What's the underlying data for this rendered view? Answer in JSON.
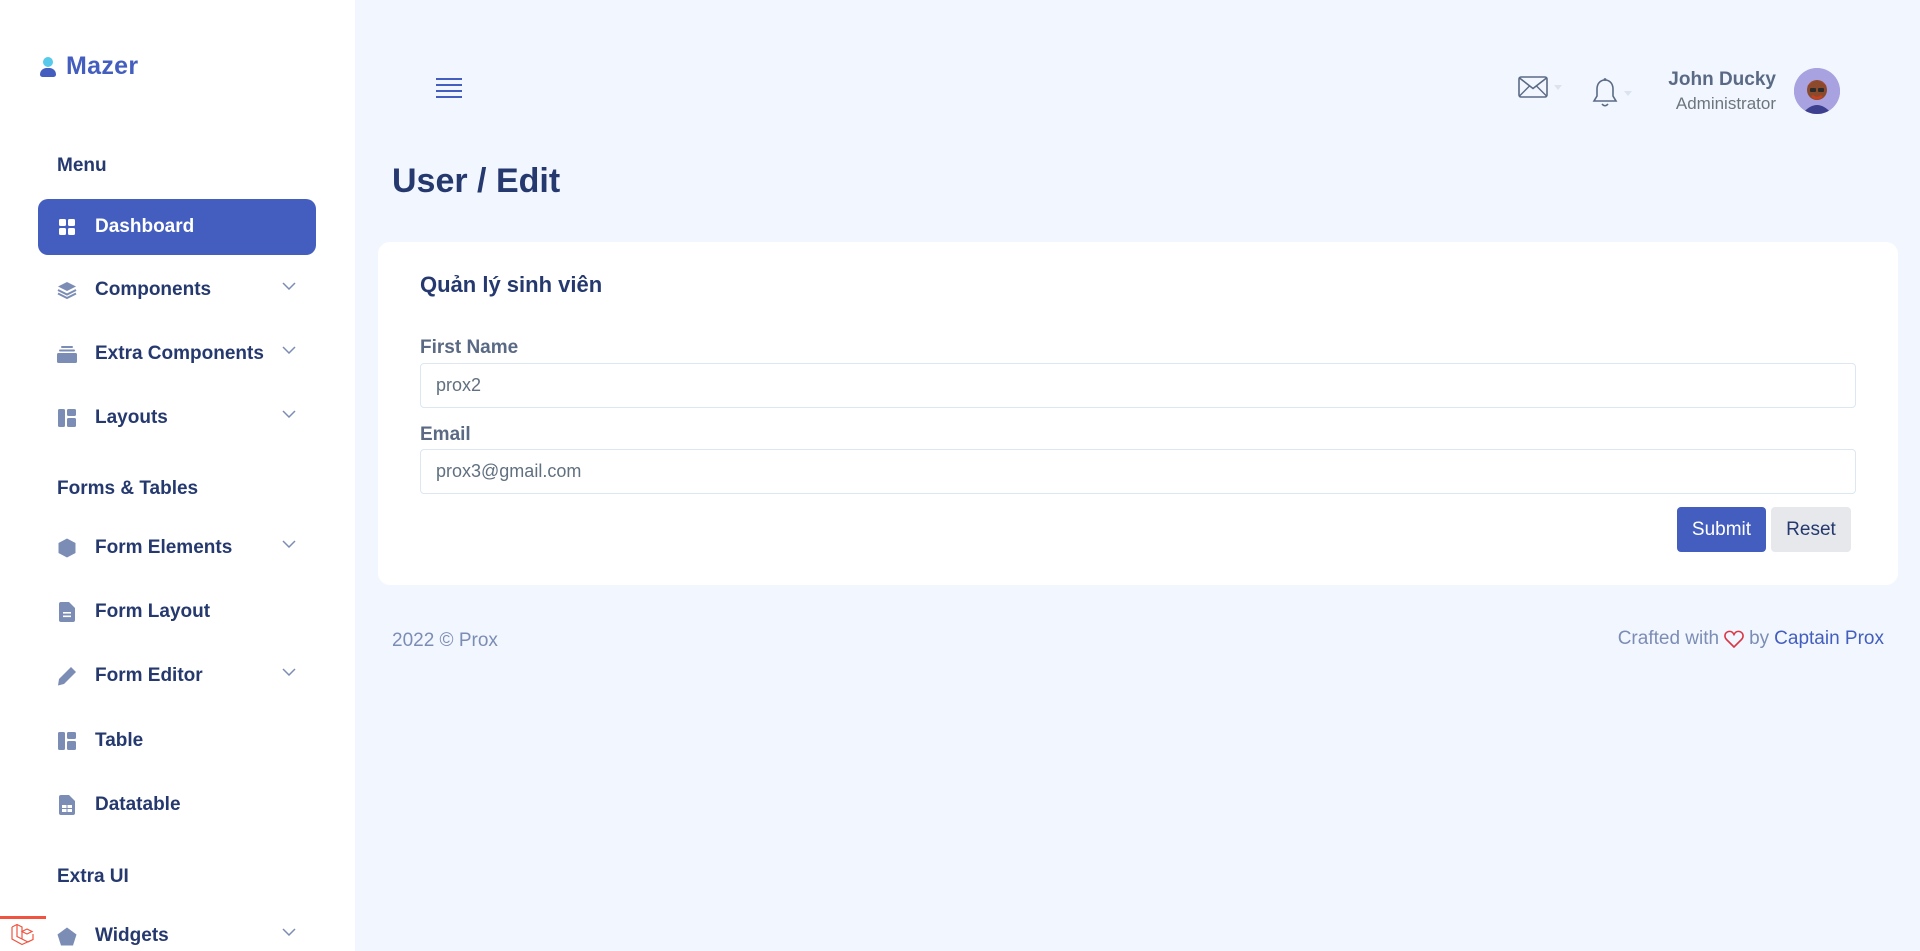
{
  "brand": {
    "name": "Mazer"
  },
  "sidebar": {
    "sections": [
      {
        "title": "Menu"
      },
      {
        "title": "Forms & Tables"
      },
      {
        "title": "Extra UI"
      }
    ],
    "items": [
      {
        "label": "Dashboard",
        "icon": "grid-icon",
        "active": true
      },
      {
        "label": "Components",
        "icon": "stack-icon"
      },
      {
        "label": "Extra Components",
        "icon": "collection-icon"
      },
      {
        "label": "Layouts",
        "icon": "layout-icon"
      },
      {
        "label": "Form Elements",
        "icon": "hexagon-icon"
      },
      {
        "label": "Form Layout",
        "icon": "file-text-icon"
      },
      {
        "label": "Form Editor",
        "icon": "pen-icon"
      },
      {
        "label": "Table",
        "icon": "layout-icon"
      },
      {
        "label": "Datatable",
        "icon": "file-spreadsheet-icon"
      },
      {
        "label": "Widgets",
        "icon": "pentagon-icon"
      }
    ]
  },
  "header": {
    "user": {
      "name": "John Ducky",
      "role": "Administrator"
    }
  },
  "page": {
    "title": "User / Edit"
  },
  "card": {
    "title": "Quản lý sinh viên",
    "fields": [
      {
        "label": "First Name",
        "value": "prox2"
      },
      {
        "label": "Email",
        "value": "prox3@gmail.com"
      }
    ],
    "buttons": {
      "submit": "Submit",
      "reset": "Reset"
    }
  },
  "footer": {
    "copyright": "2022 © Prox",
    "crafted_prefix": "Crafted with",
    "crafted_by": "by",
    "author": "Captain Prox"
  },
  "colors": {
    "primary": "#435ebe",
    "background": "#f2f7ff",
    "heading": "#25396f",
    "heart": "#dc3545"
  }
}
